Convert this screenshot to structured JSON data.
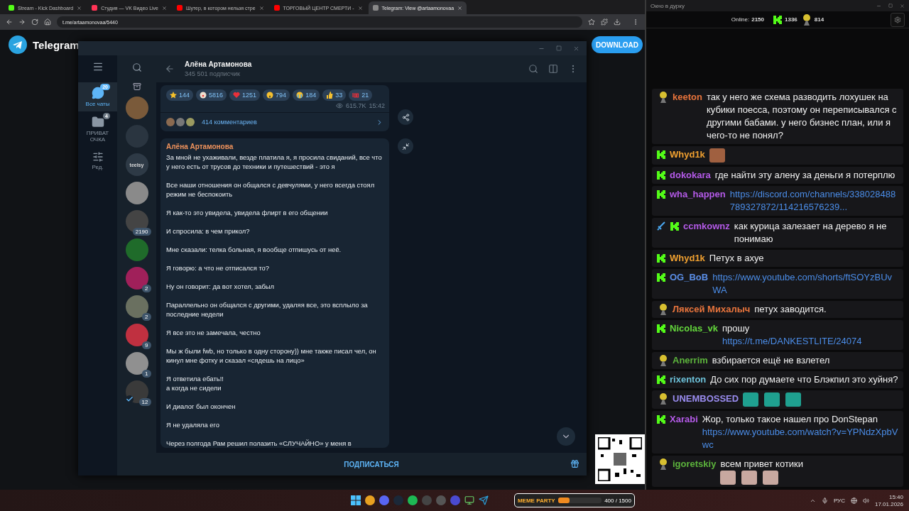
{
  "browser": {
    "tabs": [
      {
        "title": "Stream - Kick Dashboard",
        "selected": false
      },
      {
        "title": "Студия — VK Видео Live",
        "selected": false
      },
      {
        "title": "Шутер, в котором нельзя стре",
        "selected": false
      },
      {
        "title": "ТОРГОВЫЙ ЦЕНТР СМЕРТИ -",
        "selected": false
      },
      {
        "title": "Telegram: View @artaamonovaa",
        "selected": true
      }
    ],
    "url": "t.me/artaamonovaa/5440"
  },
  "telegram_page": {
    "logo_text": "Telegram",
    "download_button": "DOWNLOAD"
  },
  "telegram_window": {
    "folders": [
      {
        "kind": "chats",
        "label": "Все чаты",
        "badge": "20",
        "selected": true
      },
      {
        "kind": "folder",
        "label": "ПРИВАТ ОЧКА",
        "badge": "4",
        "selected": false
      },
      {
        "kind": "edit",
        "label": "Ред.",
        "selected": false
      }
    ],
    "chats": [
      {
        "kind": "archive",
        "verified": false
      },
      {
        "kind": "avatar",
        "verified": false
      },
      {
        "kind": "avatar",
        "verified": false
      },
      {
        "kind": "logo",
        "text": "teelsy",
        "verified": false
      },
      {
        "kind": "avatar",
        "verified": false
      },
      {
        "kind": "avatar",
        "badge": "2190",
        "verified": false
      },
      {
        "kind": "avatar",
        "verified": false
      },
      {
        "kind": "avatar",
        "badge": "2",
        "verified": false
      },
      {
        "kind": "avatar",
        "badge": "2",
        "verified": false
      },
      {
        "kind": "avatar",
        "badge": "9",
        "verified": false
      },
      {
        "kind": "avatar",
        "badge": "1",
        "verified": false
      },
      {
        "kind": "avatar",
        "badge": "12",
        "verified": true
      }
    ],
    "channel": {
      "name": "Алёна Артамонова",
      "subscribers": "345 501 подписчик"
    },
    "post": {
      "reactions": [
        {
          "kind": "star",
          "count": "144"
        },
        {
          "kind": "clown",
          "count": "5816"
        },
        {
          "kind": "heart",
          "count": "1251"
        },
        {
          "kind": "scream",
          "count": "794"
        },
        {
          "kind": "cry",
          "count": "184"
        },
        {
          "kind": "thumbs",
          "count": "33"
        },
        {
          "kind": "hundred",
          "count": "21"
        }
      ],
      "views": "615.7K",
      "time": "15:42",
      "comments": "414 комментариев"
    },
    "message": {
      "author": "Алёна Артамонова",
      "paragraphs": [
        "За мной не ухаживали, везде платила я, я просила свиданий, все что у него есть от трусов до техники и путешествий - это я",
        "Все наши отношения он общался с девчулями, у него всегда стоял режим не беспокоить",
        "Я как-то это увидела, увидела флирт в его общении",
        "И спросила: в чем прикол?",
        "Мне сказали: телка больная, я вообще отпишусь от неё.",
        "Я говорю: а что не отписался то?",
        "Ну он говорит: да вот хотел, забыл",
        "Параллельно он общался с другими, удаляя все, это всплыло за последние недели",
        "Я все это не замечала, честно",
        "Мы ж были fwb, но только в одну сторону)) мне также писал чел, он кинул мне фотку и сказал «сядешь на лицо»",
        "Я ответила ебать!!\nа когда не сидели",
        "И диалог был окончен",
        "Я не удаляла его",
        "Через полгода Рам решил полазить «СЛУЧАЙНО» у меня в"
      ]
    },
    "subscribe_button": "ПОДПИСАТЬСЯ"
  },
  "stream_chat": {
    "window_title": "Окно в дурку",
    "online_label": "Online:",
    "online": "2150",
    "kick_count": "1336",
    "avatar_count": "814",
    "messages": [
      {
        "badges": [
          {
            "kind": "avatar"
          }
        ],
        "user": "keeton",
        "color": "#e8743c",
        "parts": [
          {
            "kind": "text",
            "text": "так у него же схема разводить лохушек на кубики поесса, поэтому он переписывался с другими бабами. у него бизнес план, или я чего-то не понял?"
          }
        ]
      },
      {
        "badges": [
          {
            "kind": "kick"
          }
        ],
        "user": "Whyd1k",
        "color": "#f0a030",
        "emotes": [
          {
            "kind": "laugh"
          }
        ]
      },
      {
        "badges": [
          {
            "kind": "kick"
          }
        ],
        "user": "dokokara",
        "color": "#b45ae8",
        "parts": [
          {
            "kind": "text",
            "text": "где найти эту алену за деньги я потерплю"
          }
        ]
      },
      {
        "badges": [
          {
            "kind": "kick"
          }
        ],
        "user": "wha_happen",
        "color": "#b45ae8",
        "parts": [
          {
            "kind": "link",
            "text": "https://discord.com/channels/338028488789327872/114216576239..."
          }
        ]
      },
      {
        "badges": [
          {
            "kind": "sword"
          },
          {
            "kind": "kick"
          }
        ],
        "user": "ccmkownz",
        "color": "#b45ae8",
        "parts": [
          {
            "kind": "text",
            "text": "как курица залезает на дерево я не понимаю"
          }
        ]
      },
      {
        "badges": [
          {
            "kind": "kick"
          }
        ],
        "user": "Whyd1k",
        "color": "#f0a030",
        "parts": [
          {
            "kind": "text",
            "text": "Петух в ахуе"
          }
        ]
      },
      {
        "badges": [
          {
            "kind": "kick"
          }
        ],
        "user": "OG_BoB",
        "color": "#5b8fe8",
        "parts": [
          {
            "kind": "link",
            "text": "https://www.youtube.com/shorts/ftSOYzBUvWA"
          }
        ]
      },
      {
        "badges": [
          {
            "kind": "avatar"
          }
        ],
        "user": "Ляксей Михалыч",
        "color": "#e8743c",
        "parts": [
          {
            "kind": "text",
            "text": "петух заводится."
          }
        ]
      },
      {
        "badges": [
          {
            "kind": "kick"
          }
        ],
        "user": "Nicolas_vk",
        "color": "#64d83c",
        "parts": [
          {
            "kind": "text",
            "text": "прошу"
          },
          {
            "kind": "link",
            "text": "https://t.me/DANKESTLITE/24074"
          }
        ]
      },
      {
        "badges": [
          {
            "kind": "avatar"
          }
        ],
        "user": "Anerrim",
        "color": "#5cb43c",
        "parts": [
          {
            "kind": "text",
            "text": "взбирается ещё не взлетел"
          }
        ]
      },
      {
        "badges": [
          {
            "kind": "kick"
          }
        ],
        "user": "rixenton",
        "color": "#6cc0d8",
        "parts": [
          {
            "kind": "text",
            "text": "До сих пор думаете что Блэкпил это хуйня?"
          }
        ]
      },
      {
        "badges": [
          {
            "kind": "avatar"
          }
        ],
        "user": "UNEMBOSSED",
        "color": "#9a8cf0",
        "emotes": [
          {
            "kind": "bug"
          },
          {
            "kind": "bug"
          },
          {
            "kind": "bug"
          }
        ]
      },
      {
        "badges": [
          {
            "kind": "kick"
          }
        ],
        "user": "Xarabi",
        "color": "#b45ae8",
        "parts": [
          {
            "kind": "text",
            "text": "Жор, только такое нашел про DonStepan"
          },
          {
            "kind": "link",
            "text": "https://www.youtube.com/watch?v=YPNdzXpbVwc"
          }
        ]
      },
      {
        "badges": [
          {
            "kind": "avatar"
          }
        ],
        "user": "igoretskiy",
        "color": "#5cb43c",
        "parts": [
          {
            "kind": "text",
            "text": "всем привет котики"
          }
        ],
        "emotes": [
          {
            "kind": "cat"
          },
          {
            "kind": "cat"
          },
          {
            "kind": "cat"
          }
        ]
      }
    ]
  },
  "taskbar": {
    "widget": {
      "title": "MEME PARTY",
      "progress": "400 / 1500",
      "level": 0.267
    },
    "language": "РУС",
    "time": "15:40",
    "date": "17.01.2026"
  }
}
